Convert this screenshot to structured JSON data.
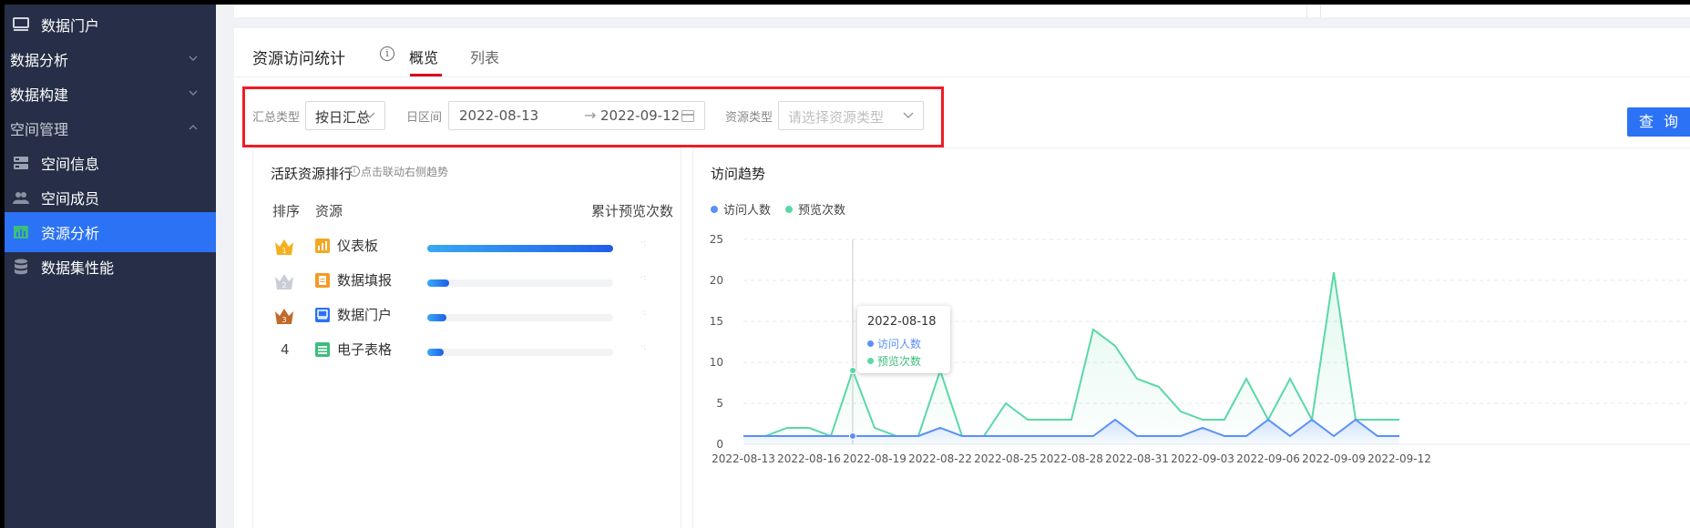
{
  "sidebar": {
    "items": [
      {
        "label": "数据门户"
      },
      {
        "label": "数据分析"
      },
      {
        "label": "数据构建"
      },
      {
        "label": "空间管理"
      },
      {
        "label": "空间信息"
      },
      {
        "label": "空间成员"
      },
      {
        "label": "资源分析"
      },
      {
        "label": "数据集性能"
      }
    ]
  },
  "header": {
    "title": "资源访问统计",
    "tabs": [
      {
        "label": "概览"
      },
      {
        "label": "列表"
      }
    ]
  },
  "filters": {
    "summary_type_label": "汇总类型",
    "summary_type_value": "按日汇总",
    "date_range_label": "日区间",
    "date_start": "2022-08-13",
    "date_end": "2022-09-12",
    "resource_type_label": "资源类型",
    "resource_type_placeholder": "请选择资源类型",
    "query_button": "查 询"
  },
  "ranking": {
    "title": "活跃资源排行",
    "hint": "点击联动右侧趋势",
    "columns": [
      "排序",
      "资源",
      "累计预览次数"
    ],
    "rows": [
      {
        "rank": "1",
        "name": "仪表板",
        "type_color": "#f5a623",
        "share": 1.0
      },
      {
        "rank": "2",
        "name": "数据填报",
        "type_color": "#f59a23",
        "share": 0.12
      },
      {
        "rank": "3",
        "name": "数据门户",
        "type_color": "#2b72f5",
        "share": 0.105
      },
      {
        "rank": "4",
        "name": "电子表格",
        "type_color": "#3dbd7d",
        "share": 0.09
      }
    ]
  },
  "trend": {
    "title": "访问趋势",
    "tooltip_date": "2022-08-18",
    "tooltip_visitors_label": "访问人数",
    "tooltip_views_label": "预览次数"
  },
  "chart_data": {
    "type": "line",
    "ylim": [
      0,
      25
    ],
    "yticks": [
      "0",
      "5",
      "10",
      "15",
      "20",
      "25"
    ],
    "xticks": [
      "2022-08-13",
      "2022-08-16",
      "2022-08-19",
      "2022-08-22",
      "2022-08-25",
      "2022-08-28",
      "2022-08-31",
      "2022-09-03",
      "2022-09-06",
      "2022-09-09",
      "2022-09-12"
    ],
    "legend_placement": "top-left",
    "series": [
      {
        "name": "访问人数",
        "color": "#5b8ff9",
        "values": [
          1,
          1,
          1,
          1,
          1,
          1,
          1,
          1,
          1,
          2,
          1,
          1,
          1,
          1,
          1,
          1,
          1,
          3,
          1,
          1,
          1,
          2,
          1,
          1,
          3,
          1,
          3,
          1,
          3,
          1,
          1
        ]
      },
      {
        "name": "预览次数",
        "color": "#5ad8a6",
        "values": [
          1,
          1,
          2,
          2,
          1,
          9,
          2,
          1,
          1,
          9,
          1,
          1,
          5,
          3,
          3,
          3,
          14,
          12,
          8,
          7,
          4,
          3,
          3,
          8,
          3,
          8,
          3,
          21,
          3,
          3,
          3
        ]
      }
    ]
  }
}
